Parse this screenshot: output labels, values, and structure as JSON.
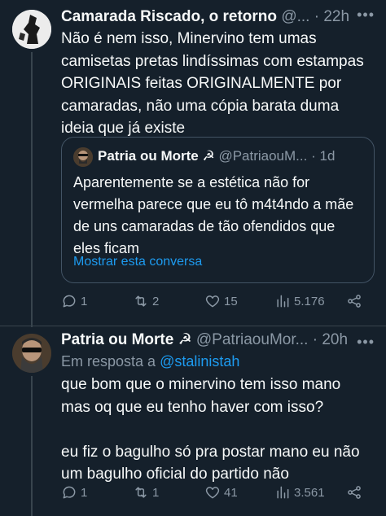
{
  "tweet1": {
    "name": "Camarada Riscado, o retorno",
    "handle": "@...",
    "dot": "·",
    "time": "22h",
    "text": "Não é nem isso, Minervino tem umas\ncamisetas pretas lindíssimas com estampas\nORIGINAIS feitas ORIGINALMENTE por\ncamaradas, não uma cópia barata duma\nideia que já existe",
    "quote": {
      "name": "Patria ou Morte ☭",
      "handle": "@PatriaouM...",
      "dot": "·",
      "time": "1d",
      "text": "Aparentemente se a estética não for vermelha parece que eu tô m4t4ndo a mãe de uns camaradas de tão ofendidos que eles ficam",
      "link": "Mostrar esta conversa"
    },
    "actions": {
      "replies": "1",
      "retweets": "2",
      "likes": "15",
      "views": "5.176"
    }
  },
  "tweet2": {
    "name": "Patria ou Morte ☭",
    "handle": "@PatriaouMor...",
    "dot": "·",
    "time": "20h",
    "reply_prefix": "Em resposta a",
    "reply_mention": "@stalinistah",
    "text": "que bom que o minervino tem isso mano\nmas oq que eu tenho haver com isso?\n\neu fiz o bagulho só pra postar mano eu não\num bagulho oficial do partido não",
    "actions": {
      "replies": "1",
      "retweets": "1",
      "likes": "41",
      "views": "3.561"
    }
  },
  "colors": {
    "background": "#15202b",
    "text": "#f7f9f9",
    "secondary": "#8b98a5",
    "accent": "#1d9bf0",
    "border": "#38444d"
  },
  "icons": [
    "more-icon",
    "reply-icon",
    "retweet-icon",
    "like-icon",
    "views-icon",
    "share-icon"
  ]
}
